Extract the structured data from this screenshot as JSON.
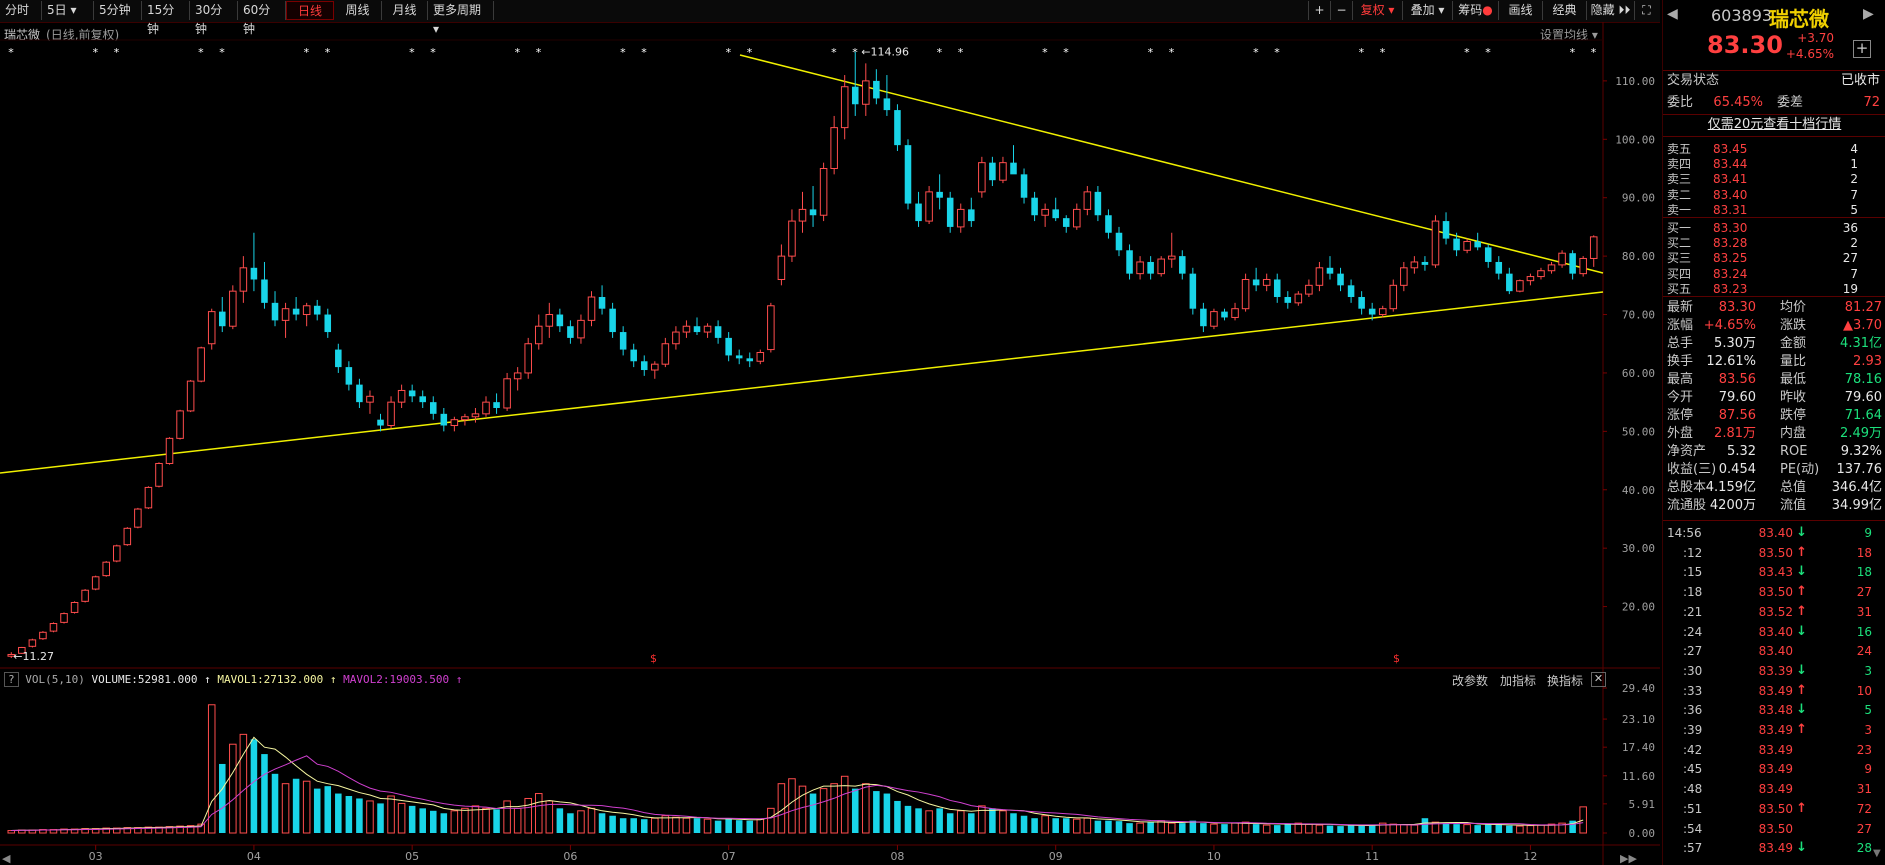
{
  "toolbar": {
    "tabs": [
      "分时",
      "5日",
      "5分钟",
      "15分钟",
      "30分钟",
      "60分钟",
      "日线",
      "周线",
      "月线",
      "更多周期"
    ],
    "active_tab": "日线",
    "right_buttons": [
      "+",
      "−",
      "复权",
      "叠加",
      "筹码",
      "画线",
      "经典",
      "隐藏"
    ]
  },
  "chart_header": {
    "name": "瑞芯微",
    "desc": "(日线,前复权)",
    "ma_settings": "设置均线"
  },
  "chart_data": {
    "type": "candlestick",
    "y_ticks": [
      "110.00",
      "100.00",
      "90.00",
      "80.00",
      "70.00",
      "60.00",
      "50.00",
      "40.00",
      "30.00",
      "20.00"
    ],
    "x_months": [
      "03",
      "04",
      "05",
      "06",
      "07",
      "08",
      "09",
      "10",
      "11",
      "12"
    ],
    "ylim": [
      10,
      117
    ],
    "high_label": "114.96",
    "low_label": "11.27",
    "candles": [
      [
        11.5,
        12.2,
        11.2,
        11.8
      ],
      [
        12.0,
        13.1,
        11.9,
        13.0
      ],
      [
        13.2,
        14.5,
        13.0,
        14.3
      ],
      [
        14.5,
        15.8,
        14.3,
        15.6
      ],
      [
        15.8,
        17.3,
        15.6,
        17.1
      ],
      [
        17.3,
        19.0,
        17.1,
        18.8
      ],
      [
        19.0,
        20.9,
        18.8,
        20.7
      ],
      [
        20.9,
        23.0,
        20.7,
        22.8
      ],
      [
        23.0,
        25.3,
        22.8,
        25.1
      ],
      [
        25.3,
        27.8,
        25.1,
        27.6
      ],
      [
        27.8,
        30.6,
        27.6,
        30.4
      ],
      [
        30.6,
        33.6,
        30.4,
        33.4
      ],
      [
        33.6,
        36.9,
        33.4,
        36.7
      ],
      [
        36.9,
        40.6,
        36.7,
        40.4
      ],
      [
        40.6,
        44.7,
        40.4,
        44.5
      ],
      [
        44.5,
        49.0,
        44.3,
        48.8
      ],
      [
        48.8,
        53.7,
        48.6,
        53.5
      ],
      [
        53.5,
        58.8,
        53.3,
        58.6
      ],
      [
        58.6,
        64.5,
        58.4,
        64.3
      ],
      [
        65.0,
        71.0,
        64.0,
        70.5
      ],
      [
        70.5,
        73.0,
        67.0,
        68.0
      ],
      [
        68.0,
        75.0,
        67.5,
        74.0
      ],
      [
        74.0,
        80.0,
        72.0,
        78.0
      ],
      [
        78.0,
        84.0,
        74.0,
        76.0
      ],
      [
        76.0,
        79.0,
        71.0,
        72.0
      ],
      [
        72.0,
        74.0,
        68.0,
        69.0
      ],
      [
        69.0,
        72.0,
        66.0,
        71.0
      ],
      [
        71.0,
        73.0,
        69.0,
        70.0
      ],
      [
        70.0,
        72.0,
        68.0,
        71.5
      ],
      [
        71.5,
        72.5,
        69.0,
        70.0
      ],
      [
        70.0,
        71.0,
        66.0,
        67.0
      ],
      [
        64.0,
        65.0,
        60.0,
        61.0
      ],
      [
        61.0,
        62.0,
        57.0,
        58.0
      ],
      [
        58.0,
        59.0,
        54.0,
        55.0
      ],
      [
        55.0,
        57.0,
        53.0,
        56.0
      ],
      [
        52.0,
        53.0,
        50.0,
        51.0
      ],
      [
        51.0,
        56.0,
        50.5,
        55.0
      ],
      [
        55.0,
        58.0,
        54.0,
        57.0
      ],
      [
        57.0,
        58.0,
        55.0,
        56.0
      ],
      [
        56.0,
        57.0,
        54.0,
        55.0
      ],
      [
        55.0,
        56.0,
        52.0,
        53.0
      ],
      [
        53.0,
        54.0,
        50.0,
        51.0
      ],
      [
        51.0,
        52.5,
        50.0,
        52.0
      ],
      [
        52.0,
        53.0,
        51.0,
        52.5
      ],
      [
        52.5,
        54.0,
        51.5,
        53.0
      ],
      [
        53.0,
        56.0,
        52.5,
        55.0
      ],
      [
        55.0,
        56.5,
        53.0,
        54.0
      ],
      [
        54.0,
        60.0,
        53.5,
        59.0
      ],
      [
        59.0,
        61.0,
        57.0,
        60.0
      ],
      [
        60.0,
        66.0,
        59.0,
        65.0
      ],
      [
        65.0,
        70.0,
        64.0,
        68.0
      ],
      [
        68.0,
        72.0,
        66.0,
        70.0
      ],
      [
        70.0,
        71.0,
        67.0,
        68.0
      ],
      [
        68.0,
        69.0,
        65.0,
        66.0
      ],
      [
        66.0,
        70.0,
        65.0,
        69.0
      ],
      [
        69.0,
        74.0,
        68.0,
        73.0
      ],
      [
        73.0,
        75.0,
        70.0,
        71.0
      ],
      [
        71.0,
        72.0,
        66.0,
        67.0
      ],
      [
        67.0,
        68.0,
        63.0,
        64.0
      ],
      [
        64.0,
        65.0,
        61.0,
        62.0
      ],
      [
        62.0,
        63.0,
        59.5,
        60.5
      ],
      [
        60.5,
        62.0,
        59.0,
        61.5
      ],
      [
        61.5,
        66.0,
        61.0,
        65.0
      ],
      [
        65.0,
        68.0,
        64.0,
        67.0
      ],
      [
        67.0,
        69.0,
        66.0,
        68.0
      ],
      [
        68.0,
        69.5,
        66.5,
        67.0
      ],
      [
        67.0,
        68.5,
        66.0,
        68.0
      ],
      [
        68.0,
        69.0,
        65.0,
        66.0
      ],
      [
        66.0,
        67.0,
        62.0,
        63.0
      ],
      [
        63.0,
        64.0,
        61.5,
        62.5
      ],
      [
        62.5,
        63.5,
        61.0,
        62.0
      ],
      [
        62.0,
        64.0,
        61.5,
        63.5
      ],
      [
        64.0,
        72.0,
        63.5,
        71.5
      ],
      [
        76.0,
        82.0,
        75.0,
        80.0
      ],
      [
        80.0,
        88.0,
        79.0,
        86.0
      ],
      [
        86.0,
        91.0,
        84.0,
        88.0
      ],
      [
        88.0,
        92.0,
        85.0,
        87.0
      ],
      [
        87.0,
        96.0,
        86.0,
        95.0
      ],
      [
        95.0,
        104.0,
        94.0,
        102.0
      ],
      [
        102.0,
        111.0,
        100.0,
        109.0
      ],
      [
        109.0,
        115.0,
        104.0,
        106.0
      ],
      [
        106.0,
        113.0,
        104.0,
        110.0
      ],
      [
        110.0,
        112.0,
        106.0,
        107.0
      ],
      [
        107.0,
        111.0,
        104.0,
        105.0
      ],
      [
        105.0,
        106.0,
        98.0,
        99.0
      ],
      [
        99.0,
        100.0,
        88.0,
        89.0
      ],
      [
        89.0,
        91.0,
        85.0,
        86.0
      ],
      [
        86.0,
        92.0,
        85.5,
        91.0
      ],
      [
        91.0,
        94.0,
        88.0,
        90.0
      ],
      [
        90.0,
        91.0,
        84.0,
        85.0
      ],
      [
        85.0,
        89.0,
        84.0,
        88.0
      ],
      [
        88.0,
        90.0,
        85.0,
        86.0
      ],
      [
        91.0,
        97.0,
        90.0,
        96.0
      ],
      [
        96.0,
        97.0,
        92.0,
        93.0
      ],
      [
        93.0,
        97.0,
        92.5,
        96.0
      ],
      [
        96.0,
        99.0,
        95.0,
        94.0
      ],
      [
        94.0,
        95.0,
        89.0,
        90.0
      ],
      [
        90.0,
        91.0,
        86.0,
        87.0
      ],
      [
        87.0,
        89.0,
        85.0,
        88.0
      ],
      [
        88.0,
        90.0,
        86.0,
        86.5
      ],
      [
        86.5,
        87.0,
        84.0,
        85.0
      ],
      [
        85.0,
        89.0,
        84.5,
        88.0
      ],
      [
        88.0,
        92.0,
        87.0,
        91.0
      ],
      [
        91.0,
        92.0,
        86.0,
        87.0
      ],
      [
        87.0,
        88.0,
        83.0,
        84.0
      ],
      [
        84.0,
        85.0,
        80.0,
        81.0
      ],
      [
        81.0,
        82.0,
        76.0,
        77.0
      ],
      [
        77.0,
        80.0,
        76.0,
        79.0
      ],
      [
        79.0,
        80.0,
        76.0,
        77.0
      ],
      [
        77.0,
        80.0,
        76.5,
        79.5
      ],
      [
        79.5,
        84.0,
        78.0,
        80.0
      ],
      [
        80.0,
        81.0,
        76.0,
        77.0
      ],
      [
        77.0,
        78.0,
        70.0,
        71.0
      ],
      [
        71.0,
        72.0,
        67.0,
        68.0
      ],
      [
        68.0,
        71.0,
        67.5,
        70.5
      ],
      [
        70.5,
        71.0,
        69.0,
        69.5
      ],
      [
        69.5,
        72.0,
        69.0,
        71.0
      ],
      [
        71.0,
        77.0,
        70.5,
        76.0
      ],
      [
        76.0,
        78.0,
        74.0,
        75.0
      ],
      [
        75.0,
        77.0,
        74.0,
        76.0
      ],
      [
        76.0,
        77.0,
        72.0,
        73.0
      ],
      [
        73.0,
        74.0,
        71.0,
        72.0
      ],
      [
        72.0,
        74.0,
        71.5,
        73.5
      ],
      [
        73.5,
        76.0,
        73.0,
        75.0
      ],
      [
        75.0,
        79.0,
        74.0,
        78.0
      ],
      [
        78.0,
        80.0,
        76.0,
        77.0
      ],
      [
        77.0,
        78.0,
        74.0,
        75.0
      ],
      [
        75.0,
        76.0,
        72.0,
        73.0
      ],
      [
        73.0,
        74.0,
        70.0,
        71.0
      ],
      [
        71.0,
        72.0,
        69.0,
        70.0
      ],
      [
        70.0,
        71.5,
        69.5,
        71.0
      ],
      [
        71.0,
        76.0,
        70.5,
        75.0
      ],
      [
        75.0,
        79.0,
        74.0,
        78.0
      ],
      [
        78.0,
        80.0,
        77.0,
        79.0
      ],
      [
        79.0,
        80.0,
        77.5,
        78.5
      ],
      [
        78.5,
        87.0,
        78.0,
        86.0
      ],
      [
        86.0,
        87.5,
        82.0,
        83.0
      ],
      [
        83.0,
        84.0,
        80.0,
        81.0
      ],
      [
        81.0,
        83.0,
        80.5,
        82.5
      ],
      [
        82.5,
        84.0,
        81.0,
        81.5
      ],
      [
        81.5,
        82.0,
        78.0,
        79.0
      ],
      [
        79.0,
        80.0,
        76.0,
        77.0
      ],
      [
        77.0,
        78.0,
        73.5,
        74.0
      ],
      [
        74.0,
        76.0,
        73.8,
        75.8
      ],
      [
        75.8,
        77.0,
        75.0,
        76.5
      ],
      [
        76.5,
        78.0,
        76.0,
        77.5
      ],
      [
        77.5,
        79.0,
        77.0,
        78.5
      ],
      [
        78.5,
        81.0,
        78.0,
        80.5
      ],
      [
        80.5,
        81.0,
        76.0,
        77.0
      ],
      [
        77.0,
        80.0,
        76.5,
        79.6
      ],
      [
        79.6,
        83.56,
        78.16,
        83.3
      ]
    ],
    "volume_ticks": [
      "29.40",
      "23.10",
      "17.40",
      "11.60",
      "5.91",
      "0.00"
    ],
    "volume": [
      0.5,
      0.6,
      0.6,
      0.7,
      0.7,
      0.8,
      0.8,
      0.9,
      0.9,
      1.0,
      1.0,
      1.1,
      1.1,
      1.2,
      1.2,
      1.3,
      1.4,
      1.5,
      1.8,
      26.0,
      14.0,
      18.0,
      20.0,
      19.0,
      16.0,
      12.0,
      10.0,
      11.0,
      10.5,
      9.0,
      9.5,
      8.0,
      7.5,
      7.0,
      6.5,
      6.0,
      7.5,
      6.0,
      5.5,
      5.0,
      4.5,
      4.0,
      4.5,
      5.0,
      5.5,
      5.0,
      4.8,
      6.5,
      5.0,
      7.0,
      8.0,
      6.5,
      5.0,
      4.0,
      4.5,
      5.0,
      4.0,
      3.5,
      3.0,
      3.0,
      2.8,
      3.0,
      3.5,
      3.2,
      3.0,
      3.0,
      2.8,
      2.5,
      3.0,
      2.6,
      2.5,
      2.8,
      5.0,
      10.0,
      11.0,
      9.5,
      8.0,
      9.0,
      10.0,
      11.5,
      9.0,
      10.0,
      8.5,
      8.0,
      6.5,
      5.5,
      5.0,
      4.5,
      5.0,
      4.0,
      4.5,
      4.0,
      5.5,
      5.0,
      4.5,
      4.0,
      3.5,
      3.0,
      3.5,
      3.0,
      3.0,
      2.8,
      3.0,
      2.5,
      2.5,
      2.4,
      2.0,
      2.0,
      2.2,
      2.5,
      2.0,
      2.0,
      2.5,
      2.0,
      1.8,
      1.8,
      2.0,
      2.2,
      1.8,
      1.6,
      1.6,
      1.8,
      2.0,
      1.8,
      1.6,
      1.5,
      1.4,
      1.6,
      1.5,
      1.6,
      2.0,
      1.8,
      1.7,
      1.6,
      3.0,
      2.2,
      2.0,
      1.8,
      1.7,
      1.6,
      1.7,
      1.8,
      1.5,
      1.4,
      1.5,
      1.6,
      1.8,
      2.0,
      2.5,
      5.3
    ],
    "volume_header": {
      "title": "VOL(5,10)",
      "volume": "VOLUME:52981.000",
      "mavol1": "MAVOL1:27132.000",
      "mavol2": "MAVOL2:19003.500"
    },
    "volume_tools": [
      "改参数",
      "加指标",
      "换指标"
    ]
  },
  "stock": {
    "code": "603893",
    "name": "瑞芯微",
    "price": "83.30",
    "change": "+3.70",
    "change_pct": "+4.65%"
  },
  "status": {
    "label": "交易状态",
    "value": "已收市"
  },
  "ratio": {
    "label1": "委比",
    "val1": "65.45%",
    "label2": "委差",
    "val2": "72"
  },
  "promo": "仅需20元查看十档行情",
  "asks": [
    {
      "label": "卖五",
      "price": "83.45",
      "vol": "4"
    },
    {
      "label": "卖四",
      "price": "83.44",
      "vol": "1"
    },
    {
      "label": "卖三",
      "price": "83.41",
      "vol": "2"
    },
    {
      "label": "卖二",
      "price": "83.40",
      "vol": "7"
    },
    {
      "label": "卖一",
      "price": "83.31",
      "vol": "5"
    }
  ],
  "bids": [
    {
      "label": "买一",
      "price": "83.30",
      "vol": "36"
    },
    {
      "label": "买二",
      "price": "83.28",
      "vol": "2"
    },
    {
      "label": "买三",
      "price": "83.25",
      "vol": "27"
    },
    {
      "label": "买四",
      "price": "83.24",
      "vol": "7"
    },
    {
      "label": "买五",
      "price": "83.23",
      "vol": "19"
    }
  ],
  "stats": [
    {
      "l1": "最新",
      "v1": "83.30",
      "c1": "red",
      "l2": "均价",
      "v2": "81.27",
      "c2": "red"
    },
    {
      "l1": "涨幅",
      "v1": "+4.65%",
      "c1": "red",
      "l2": "涨跌",
      "v2": "▲3.70",
      "c2": "red"
    },
    {
      "l1": "总手",
      "v1": "5.30万",
      "c1": "white",
      "l2": "金额",
      "v2": "4.31亿",
      "c2": "green"
    },
    {
      "l1": "换手",
      "v1": "12.61%",
      "c1": "white",
      "l2": "量比",
      "v2": "2.93",
      "c2": "red"
    },
    {
      "l1": "最高",
      "v1": "83.56",
      "c1": "red",
      "l2": "最低",
      "v2": "78.16",
      "c2": "green"
    },
    {
      "l1": "今开",
      "v1": "79.60",
      "c1": "white",
      "l2": "昨收",
      "v2": "79.60",
      "c2": "white"
    },
    {
      "l1": "涨停",
      "v1": "87.56",
      "c1": "red",
      "l2": "跌停",
      "v2": "71.64",
      "c2": "green"
    },
    {
      "l1": "外盘",
      "v1": "2.81万",
      "c1": "red",
      "l2": "内盘",
      "v2": "2.49万",
      "c2": "green"
    },
    {
      "l1": "净资产",
      "v1": "5.32",
      "c1": "white",
      "l2": "ROE",
      "v2": "9.32%",
      "c2": "white"
    },
    {
      "l1": "收益(三)",
      "v1": "0.454",
      "c1": "white",
      "l2": "PE(动)",
      "v2": "137.76",
      "c2": "white"
    },
    {
      "l1": "总股本",
      "v1": "4.159亿",
      "c1": "white",
      "l2": "总值",
      "v2": "346.4亿",
      "c2": "white"
    },
    {
      "l1": "流通股",
      "v1": "4200万",
      "c1": "white",
      "l2": "流值",
      "v2": "34.99亿",
      "c2": "white"
    }
  ],
  "ticks": [
    {
      "time": "14:56",
      "price": "83.40",
      "dir": "down",
      "vol": "9"
    },
    {
      "time": ":12",
      "price": "83.50",
      "dir": "up",
      "vol": "18"
    },
    {
      "time": ":15",
      "price": "83.43",
      "dir": "down",
      "vol": "18"
    },
    {
      "time": ":18",
      "price": "83.50",
      "dir": "up",
      "vol": "27"
    },
    {
      "time": ":21",
      "price": "83.52",
      "dir": "up",
      "vol": "31"
    },
    {
      "time": ":24",
      "price": "83.40",
      "dir": "down",
      "vol": "16"
    },
    {
      "time": ":27",
      "price": "83.40",
      "dir": "none",
      "vol": "24"
    },
    {
      "time": ":30",
      "price": "83.39",
      "dir": "down",
      "vol": "3"
    },
    {
      "time": ":33",
      "price": "83.49",
      "dir": "up",
      "vol": "10"
    },
    {
      "time": ":36",
      "price": "83.48",
      "dir": "down",
      "vol": "5"
    },
    {
      "time": ":39",
      "price": "83.49",
      "dir": "up",
      "vol": "3"
    },
    {
      "time": ":42",
      "price": "83.49",
      "dir": "none",
      "vol": "23"
    },
    {
      "time": ":45",
      "price": "83.49",
      "dir": "none",
      "vol": "9"
    },
    {
      "time": ":48",
      "price": "83.49",
      "dir": "none",
      "vol": "31"
    },
    {
      "time": ":51",
      "price": "83.50",
      "dir": "up",
      "vol": "72"
    },
    {
      "time": ":54",
      "price": "83.50",
      "dir": "none",
      "vol": "27"
    },
    {
      "time": ":57",
      "price": "83.49",
      "dir": "down",
      "vol": "28"
    }
  ],
  "colors": {
    "up": "#ff4d4d",
    "down": "#19d4e8",
    "trend": "#f0f000",
    "ma1": "#f5f5a0",
    "ma2": "#d040d0"
  }
}
